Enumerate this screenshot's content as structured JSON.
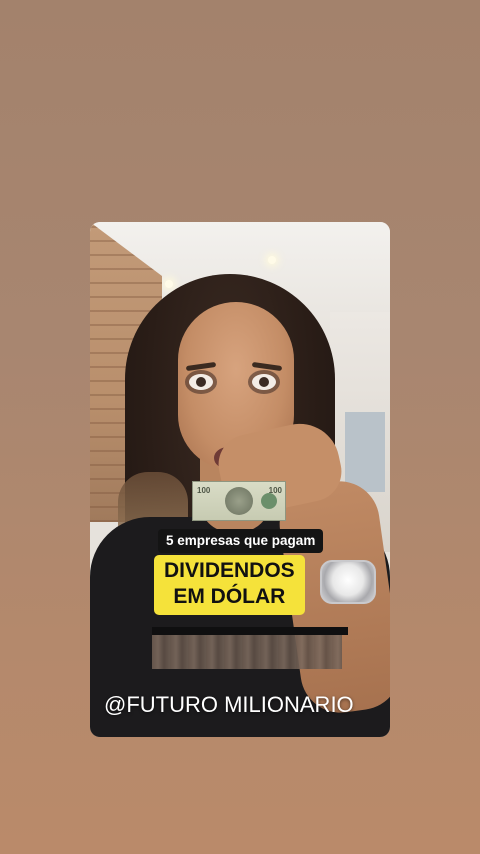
{
  "story": {
    "caption": "5 empresas que pagam",
    "headline": {
      "line1": "DIVIDENDOS",
      "line2": "EM DÓLAR"
    },
    "handle": "@FUTURO MILIONARIO",
    "bill": {
      "denomination": "100"
    }
  },
  "colors": {
    "page_background": "#a88670",
    "headline_highlight": "#f5e23a",
    "caption_background": "#141414",
    "handle_text": "#ffffff"
  }
}
